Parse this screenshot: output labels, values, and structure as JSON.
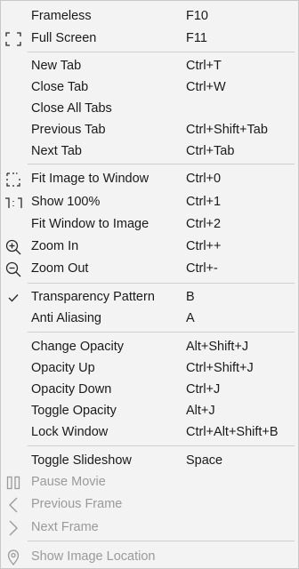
{
  "menu": {
    "frameless": {
      "label": "Frameless",
      "shortcut": "F10"
    },
    "full_screen": {
      "label": "Full Screen",
      "shortcut": "F11",
      "icon": "fullscreen-icon"
    },
    "new_tab": {
      "label": "New Tab",
      "shortcut": "Ctrl+T"
    },
    "close_tab": {
      "label": "Close Tab",
      "shortcut": "Ctrl+W"
    },
    "close_all_tabs": {
      "label": "Close All Tabs",
      "shortcut": ""
    },
    "previous_tab": {
      "label": "Previous Tab",
      "shortcut": "Ctrl+Shift+Tab"
    },
    "next_tab": {
      "label": "Next Tab",
      "shortcut": "Ctrl+Tab"
    },
    "fit_image_to_window": {
      "label": "Fit Image to Window",
      "shortcut": "Ctrl+0",
      "icon": "fit-image-icon"
    },
    "show_100": {
      "label": "Show 100%",
      "shortcut": "Ctrl+1",
      "icon": "actual-size-icon"
    },
    "fit_window_to_image": {
      "label": "Fit Window to Image",
      "shortcut": "Ctrl+2"
    },
    "zoom_in": {
      "label": "Zoom In",
      "shortcut": "Ctrl++",
      "icon": "zoom-in-icon"
    },
    "zoom_out": {
      "label": "Zoom Out",
      "shortcut": "Ctrl+-",
      "icon": "zoom-out-icon"
    },
    "transparency_pattern": {
      "label": "Transparency Pattern",
      "shortcut": "B",
      "checked": true,
      "icon": "checkmark-icon"
    },
    "anti_aliasing": {
      "label": "Anti Aliasing",
      "shortcut": "A"
    },
    "change_opacity": {
      "label": "Change Opacity",
      "shortcut": "Alt+Shift+J"
    },
    "opacity_up": {
      "label": "Opacity Up",
      "shortcut": "Ctrl+Shift+J"
    },
    "opacity_down": {
      "label": "Opacity Down",
      "shortcut": "Ctrl+J"
    },
    "toggle_opacity": {
      "label": "Toggle Opacity",
      "shortcut": "Alt+J"
    },
    "lock_window": {
      "label": "Lock Window",
      "shortcut": "Ctrl+Alt+Shift+B"
    },
    "toggle_slideshow": {
      "label": "Toggle Slideshow",
      "shortcut": "Space"
    },
    "pause_movie": {
      "label": "Pause Movie",
      "shortcut": "",
      "disabled": true,
      "icon": "pause-icon"
    },
    "previous_frame": {
      "label": "Previous Frame",
      "shortcut": "",
      "disabled": true,
      "icon": "chevron-left-icon"
    },
    "next_frame": {
      "label": "Next Frame",
      "shortcut": "",
      "disabled": true,
      "icon": "chevron-right-icon"
    },
    "show_image_location": {
      "label": "Show Image Location",
      "shortcut": "",
      "disabled": true,
      "icon": "location-pin-icon"
    }
  },
  "colors": {
    "background": "#f3f3f3",
    "text": "#1a1a1a",
    "disabled_text": "#9a9a9a",
    "separator": "#cfcfcf"
  }
}
